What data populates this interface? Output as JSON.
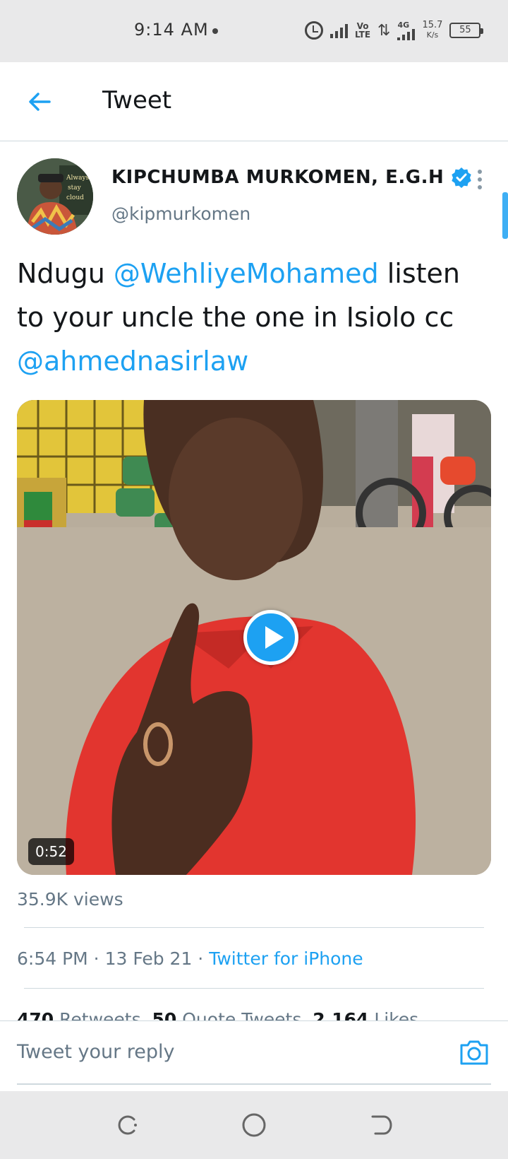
{
  "status_bar": {
    "time": "9:14 AM",
    "network_speed": "15.7",
    "network_speed_unit": "K/s",
    "network_type": "4G",
    "lte_label": "Vo\nLTE",
    "battery": "55",
    "icons": [
      "alarm-icon",
      "signal-icon",
      "volte-icon",
      "data-arrows-icon",
      "signal-4g-icon",
      "battery-icon"
    ]
  },
  "header": {
    "title": "Tweet",
    "back_icon": "arrow-left-icon"
  },
  "author": {
    "name": "KIPCHUMBA MURKOMEN, E.G.H",
    "handle": "@kipmurkomen",
    "verified": true
  },
  "tweet": {
    "text_parts": [
      {
        "text": "Ndugu ",
        "type": "plain"
      },
      {
        "text": "@WehliyeMohamed",
        "type": "mention"
      },
      {
        "text": " listen to your uncle the one in Isiolo cc ",
        "type": "plain"
      },
      {
        "text": "@ahmednasirlaw",
        "type": "mention"
      }
    ]
  },
  "media": {
    "type": "video",
    "duration": "0:52"
  },
  "meta": {
    "views": "35.9K views",
    "time": "6:54 PM",
    "separator": " · ",
    "date": "13 Feb 21",
    "source": "Twitter for iPhone"
  },
  "stats": {
    "retweets_count": "470",
    "retweets_label": " Retweets",
    "quotes_count": "50",
    "quotes_label": " Quote Tweets",
    "likes_count": "2,164",
    "likes_label": " Likes"
  },
  "reply": {
    "placeholder": "Tweet your reply"
  },
  "colors": {
    "accent": "#1da1f2",
    "secondary_text": "#657786",
    "system_bar": "#e9e9ea"
  }
}
